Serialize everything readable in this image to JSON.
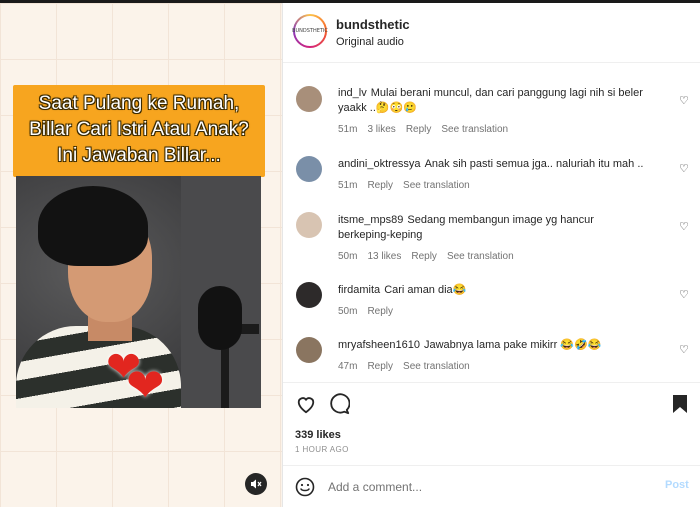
{
  "media": {
    "caption_lines": [
      "Saat Pulang ke Rumah,",
      "Billar Cari Istri Atau Anak?",
      "Ini Jawaban Billar..."
    ],
    "mute_icon": "volume-mute-icon"
  },
  "header": {
    "username": "bundsthetic",
    "subtitle": "Original audio",
    "avatar_text": "BUNDSTHETIC"
  },
  "comments": [
    {
      "user": "ind_lv",
      "text": "Mulai berani muncul, dan cari panggung lagi nih si beler yaakk ..🤔😳🥲",
      "time": "51m",
      "likes": "3 likes",
      "reply": "Reply",
      "translate": "See translation",
      "avatar_color": "#a88f7a"
    },
    {
      "user": "andini_oktressya",
      "text": "Anak sih pasti semua jga.. naluriah itu mah ..",
      "time": "51m",
      "likes": "",
      "reply": "Reply",
      "translate": "See translation",
      "avatar_color": "#7a8fa8"
    },
    {
      "user": "itsme_mps89",
      "text": "Sedang membangun image yg hancur berkeping-keping",
      "time": "50m",
      "likes": "13 likes",
      "reply": "Reply",
      "translate": "See translation",
      "avatar_color": "#d8c4b2"
    },
    {
      "user": "firdamita",
      "text": "Cari aman dia😂",
      "time": "50m",
      "likes": "",
      "reply": "Reply",
      "translate": "",
      "avatar_color": "#2d2a2a"
    },
    {
      "user": "mryafsheen1610",
      "text": "Jawabnya lama pake mikirr 😂🤣😂",
      "time": "47m",
      "likes": "",
      "reply": "Reply",
      "translate": "See translation",
      "avatar_color": "#8a7560"
    }
  ],
  "actions": {
    "like_icon": "heart-icon",
    "comment_icon": "comment-icon",
    "save_icon": "bookmark-icon"
  },
  "stats": {
    "likes": "339 likes",
    "posted": "1 HOUR AGO"
  },
  "add_comment": {
    "placeholder": "Add a comment...",
    "post_label": "Post"
  },
  "colors": {
    "caption_bg": "#f7a51f",
    "post_disabled": "#b3dbff",
    "meta_gray": "#737373"
  }
}
